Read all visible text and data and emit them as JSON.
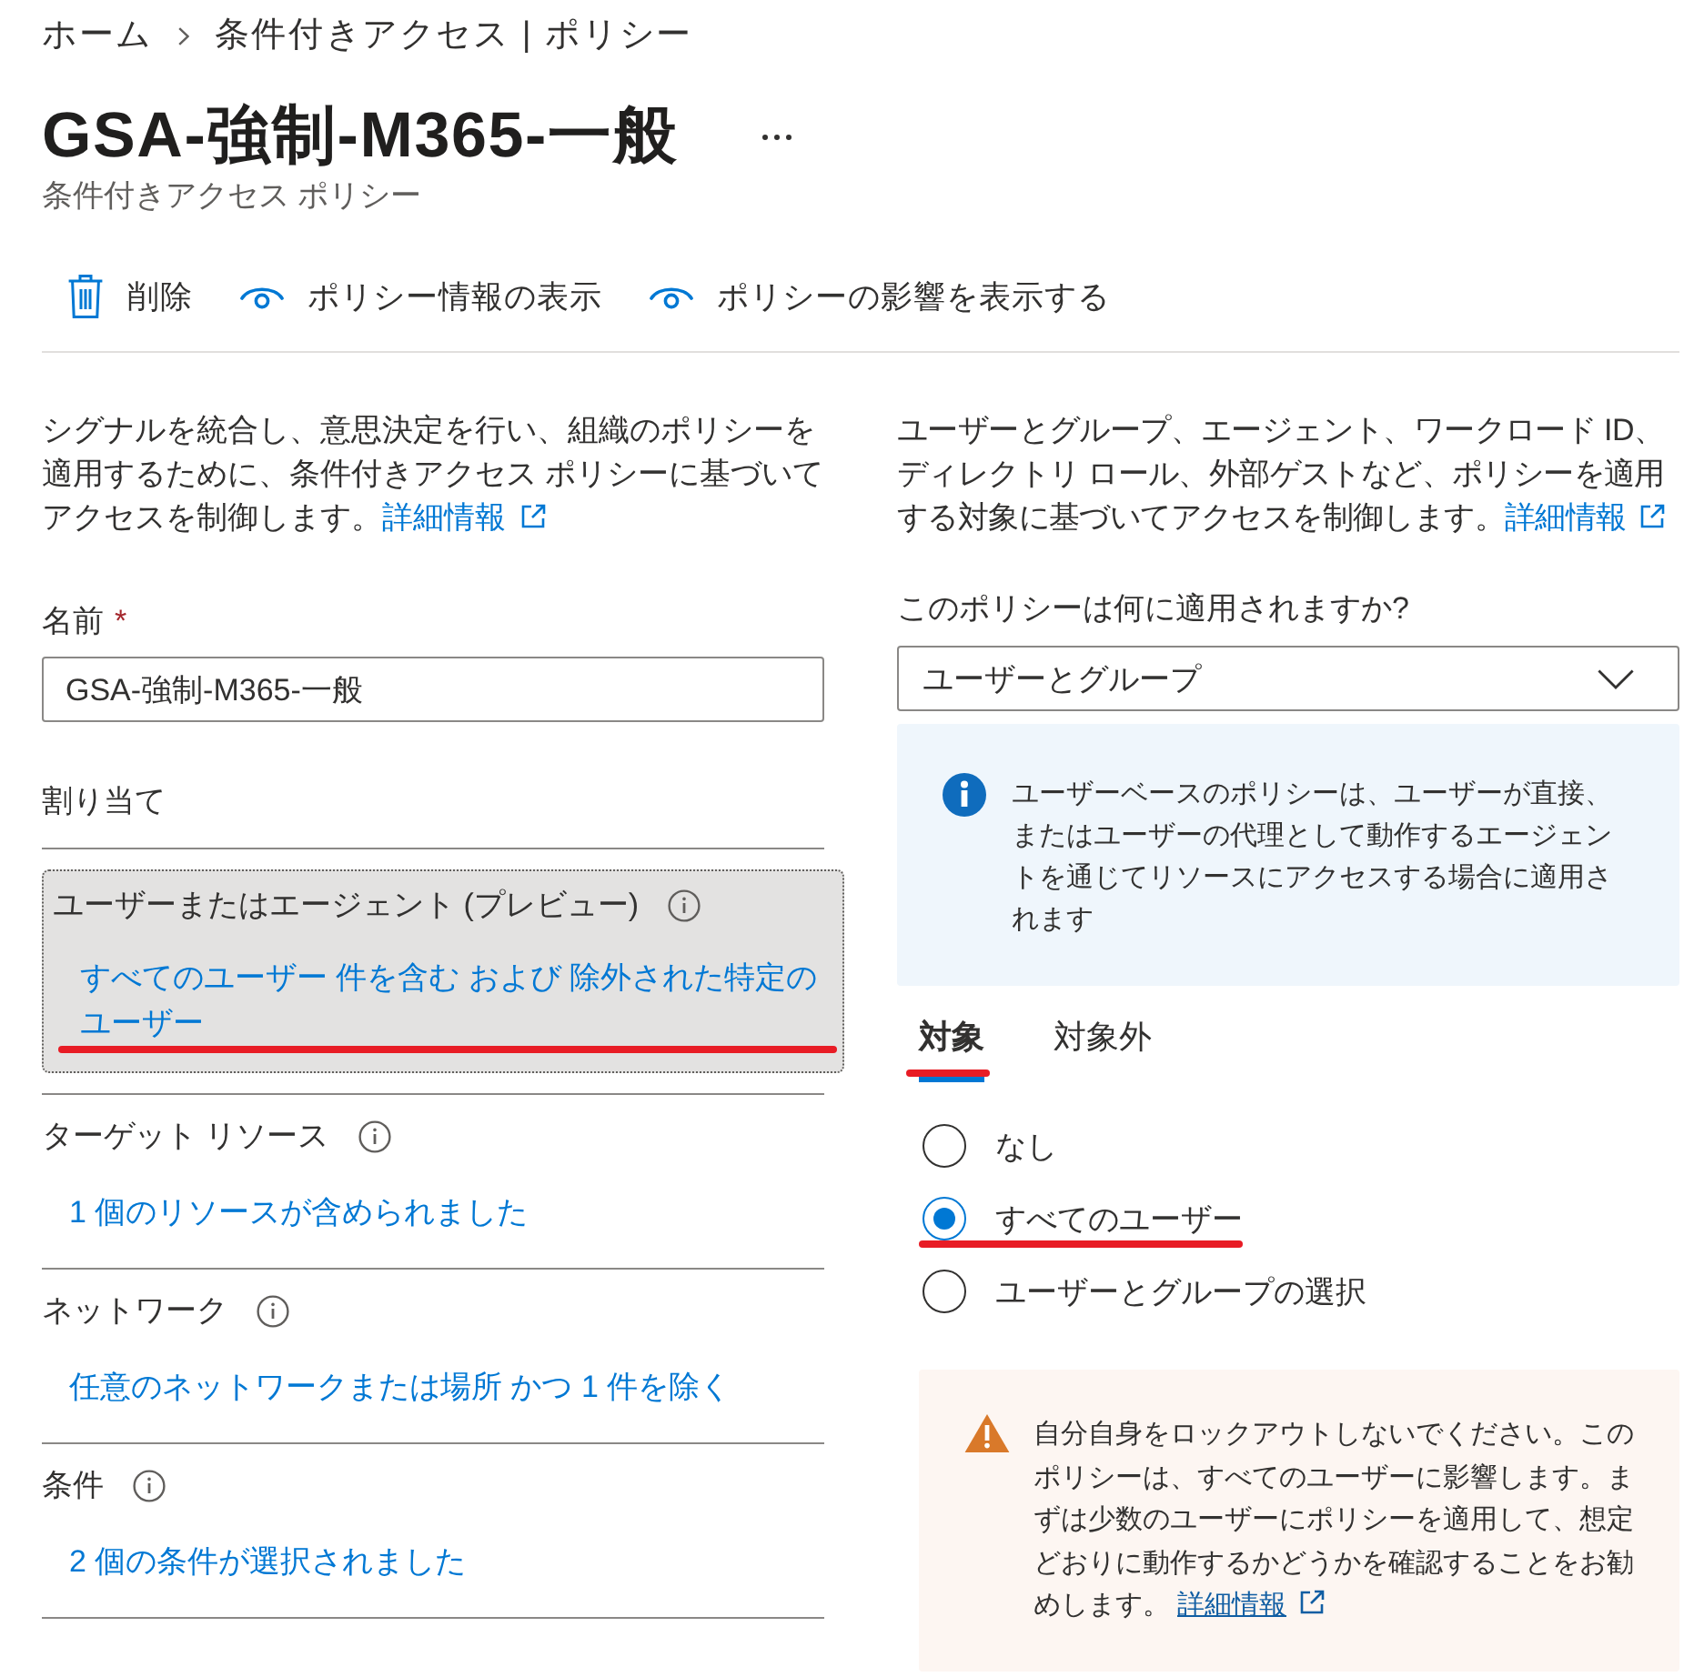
{
  "breadcrumb": [
    {
      "label": "ホーム"
    },
    {
      "label": "条件付きアクセス | ポリシー"
    }
  ],
  "header": {
    "title": "GSA-強制-M365-一般",
    "subtitle": "条件付きアクセス ポリシー"
  },
  "toolbar": [
    {
      "kind": "delete",
      "label": "削除"
    },
    {
      "kind": "view",
      "label": "ポリシー情報の表示"
    },
    {
      "kind": "view",
      "label": "ポリシーの影響を表示する"
    }
  ],
  "left": {
    "description": "シグナルを統合し、意思決定を行い、組織のポリシーを適用するために、条件付きアクセス ポリシーに基づいてアクセスを制御します。",
    "description_link": "詳細情報",
    "name_field": {
      "label": "名前",
      "required_mark": "*",
      "value": "GSA-強制-M365-一般"
    },
    "assignments": {
      "heading": "割り当て",
      "items": [
        {
          "label": "ユーザーまたはエージェント (プレビュー)",
          "summary": "すべてのユーザー 件を含む および 除外された特定のユーザー",
          "selected": true,
          "highlighted": true
        },
        {
          "label": "ターゲット リソース",
          "summary": "1 個のリソースが含められました",
          "selected": false,
          "highlighted": false
        },
        {
          "label": "ネットワーク",
          "summary": "任意のネットワークまたは場所 かつ 1 件を除く",
          "selected": false,
          "highlighted": false
        },
        {
          "label": "条件",
          "summary": "2 個の条件が選択されました",
          "selected": false,
          "highlighted": false
        }
      ]
    }
  },
  "right": {
    "description": "ユーザーとグループ、エージェント、ワークロード ID、ディレクトリ ロール、外部ゲストなど、ポリシーを適用する対象に基づいてアクセスを制御します。",
    "description_link": "詳細情報",
    "question": "このポリシーは何に適用されますか?",
    "dropdown": {
      "value": "ユーザーとグループ"
    },
    "info": "ユーザーベースのポリシーは、ユーザーが直接、またはユーザーの代理として動作するエージェントを通じてリソースにアクセスする場合に適用されます",
    "tabs": [
      {
        "label": "対象",
        "selected": true,
        "highlighted": true
      },
      {
        "label": "対象外",
        "selected": false,
        "highlighted": false
      }
    ],
    "options": [
      {
        "label": "なし",
        "selected": false,
        "highlighted": false
      },
      {
        "label": "すべてのユーザー",
        "selected": true,
        "highlighted": true
      },
      {
        "label": "ユーザーとグループの選択",
        "selected": false,
        "highlighted": false
      }
    ],
    "warning": {
      "text": "自分自身をロックアウトしないでください。このポリシーは、すべてのユーザーに影響します。まずは少数のユーザーにポリシーを適用して、想定どおりに動作するかどうかを確認することをお勧めします。",
      "link": "詳細情報"
    }
  }
}
